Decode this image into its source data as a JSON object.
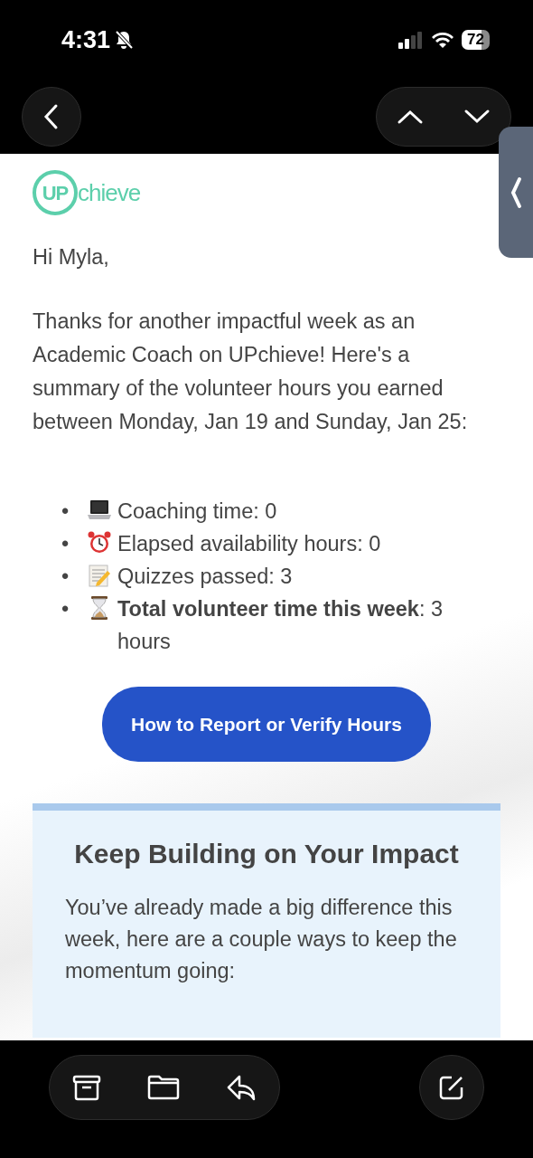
{
  "status_bar": {
    "time": "4:31",
    "battery": "72"
  },
  "email": {
    "logo": {
      "circle_text": "UP",
      "text": "chieve"
    },
    "greeting": "Hi Myla,",
    "intro": "Thanks for another impactful week as an Academic Coach on UPchieve! Here's a summary of the volunteer hours you earned between Monday, Jan 19 and Sunday, Jan 25:",
    "items": [
      {
        "bullet": "•",
        "kind": "laptop",
        "text": "Coaching time: 0"
      },
      {
        "bullet": "•",
        "kind": "alarm",
        "text": "Elapsed availability hours: 0"
      },
      {
        "bullet": "•",
        "kind": "memo",
        "text": "Quizzes passed: 3"
      },
      {
        "bullet": "•",
        "kind": "hourglass",
        "text": "**Total volunteer time this week**: 3 hours"
      }
    ],
    "button": "How to Report or Verify Hours",
    "panel": {
      "title": "Keep Building on Your Impact",
      "text": "You’ve already made a big difference this week, here are a couple ways to keep the momentum going:"
    }
  }
}
